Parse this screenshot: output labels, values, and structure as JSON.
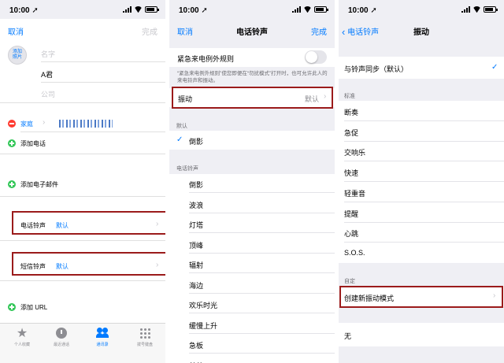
{
  "status": {
    "time": "10:00",
    "loc": "➚"
  },
  "p1": {
    "cancel": "取消",
    "done": "完成",
    "avatar": "添加照片",
    "first_name_ph": "名字",
    "last_name": "A君",
    "company_ph": "公司",
    "phone_label": "家庭",
    "add_phone": "添加电话",
    "add_email": "添加电子邮件",
    "ringtone_label": "电话铃声",
    "ringtone_value": "默认",
    "sms_label": "短信铃声",
    "sms_value": "默认",
    "add_url": "添加 URL",
    "tabs": [
      {
        "label": "个人收藏"
      },
      {
        "label": "最近通话"
      },
      {
        "label": "通讯录"
      },
      {
        "label": "拨号键盘"
      }
    ]
  },
  "p2": {
    "cancel": "取消",
    "title": "电话铃声",
    "done": "完成",
    "emergency": "紧急来电例外规则",
    "emergency_note": "“紧急来电例外规则”使您即便在“勿扰模式”打开时，也可允许此人的来电铃声和振动。",
    "vibration_label": "振动",
    "vibration_value": "默认",
    "default_header": "默认",
    "default_item": "倒影",
    "ringtones_header": "电话铃声",
    "ringtones": [
      "倒影",
      "波浪",
      "灯塔",
      "顶峰",
      "辐射",
      "海边",
      "欢乐时光",
      "缓慢上升",
      "急板",
      "煎茶"
    ]
  },
  "p3": {
    "back": "电话铃声",
    "title": "振动",
    "sync": "与铃声同步（默认）",
    "standard_header": "标准",
    "standard": [
      "断奏",
      "急促",
      "交响乐",
      "快速",
      "轻重音",
      "提醒",
      "心跳",
      "S.O.S."
    ],
    "custom_header": "自定",
    "create": "创建新振动模式",
    "none": "无"
  }
}
